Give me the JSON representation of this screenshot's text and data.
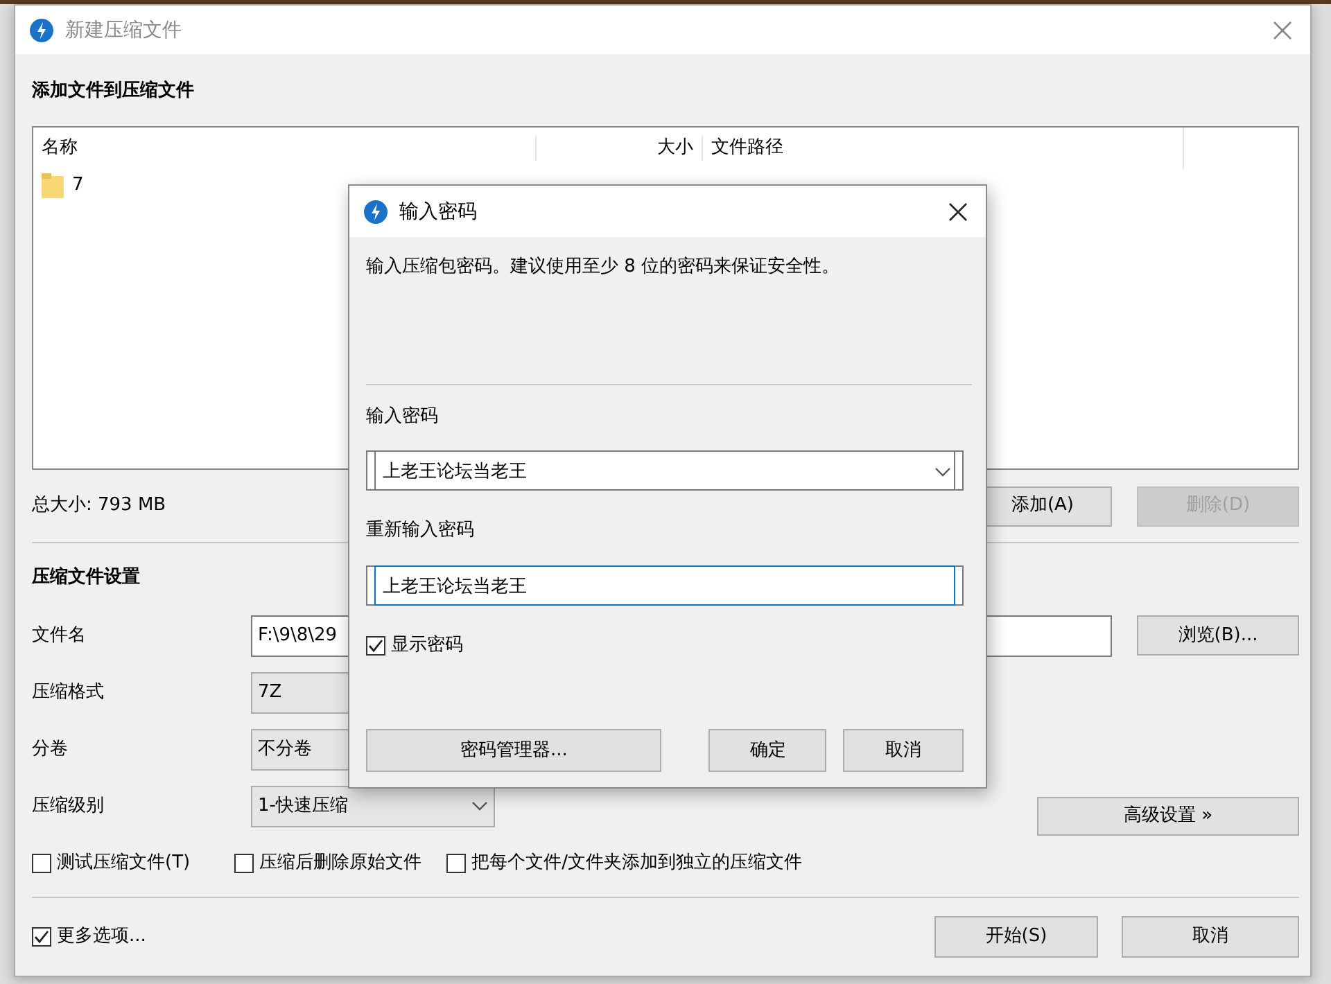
{
  "window": {
    "title": "新建压缩文件"
  },
  "files_section": {
    "heading": "添加文件到压缩文件",
    "columns": [
      "名称",
      "大小",
      "文件路径"
    ],
    "rows": [
      {
        "kind": "folder",
        "name": "7"
      }
    ],
    "total": "总大小: 793 MB",
    "buttons": [
      {
        "label": "添加(A)",
        "disabled": false
      },
      {
        "label": "删除(D)",
        "disabled": true
      }
    ]
  },
  "settings": {
    "heading": "压缩文件设置",
    "fields": [
      {
        "kind": "text",
        "label": "文件名",
        "value": "F:\\9\\8\\29"
      },
      {
        "kind": "select",
        "label": "压缩格式",
        "value": "7Z"
      },
      {
        "kind": "select",
        "label": "分卷",
        "value": "不分卷"
      },
      {
        "kind": "dropdown",
        "label": "压缩级别",
        "value": "1-快速压缩"
      }
    ],
    "browse_button": "浏览(B)...",
    "advanced_button": "高级设置 »",
    "options": [
      {
        "label": "测试压缩文件(T)",
        "checked": false
      },
      {
        "label": "压缩后删除原始文件",
        "checked": false
      },
      {
        "label": "把每个文件/文件夹添加到独立的压缩文件",
        "checked": false
      }
    ]
  },
  "footer": {
    "more_options": {
      "label": "更多选项...",
      "checked": true
    },
    "buttons": [
      "开始(S)",
      "取消"
    ]
  },
  "dialog": {
    "title": "输入密码",
    "message": "输入压缩包密码。建议使用至少 8 位的密码来保证安全性。",
    "password_label": "输入密码",
    "password": "上老王论坛当老王",
    "confirm_label": "重新输入密码",
    "confirm": "上老王论坛当老王",
    "show_password": {
      "label": "显示密码",
      "checked": true
    },
    "buttons": [
      "密码管理器...",
      "确定",
      "取消"
    ]
  }
}
